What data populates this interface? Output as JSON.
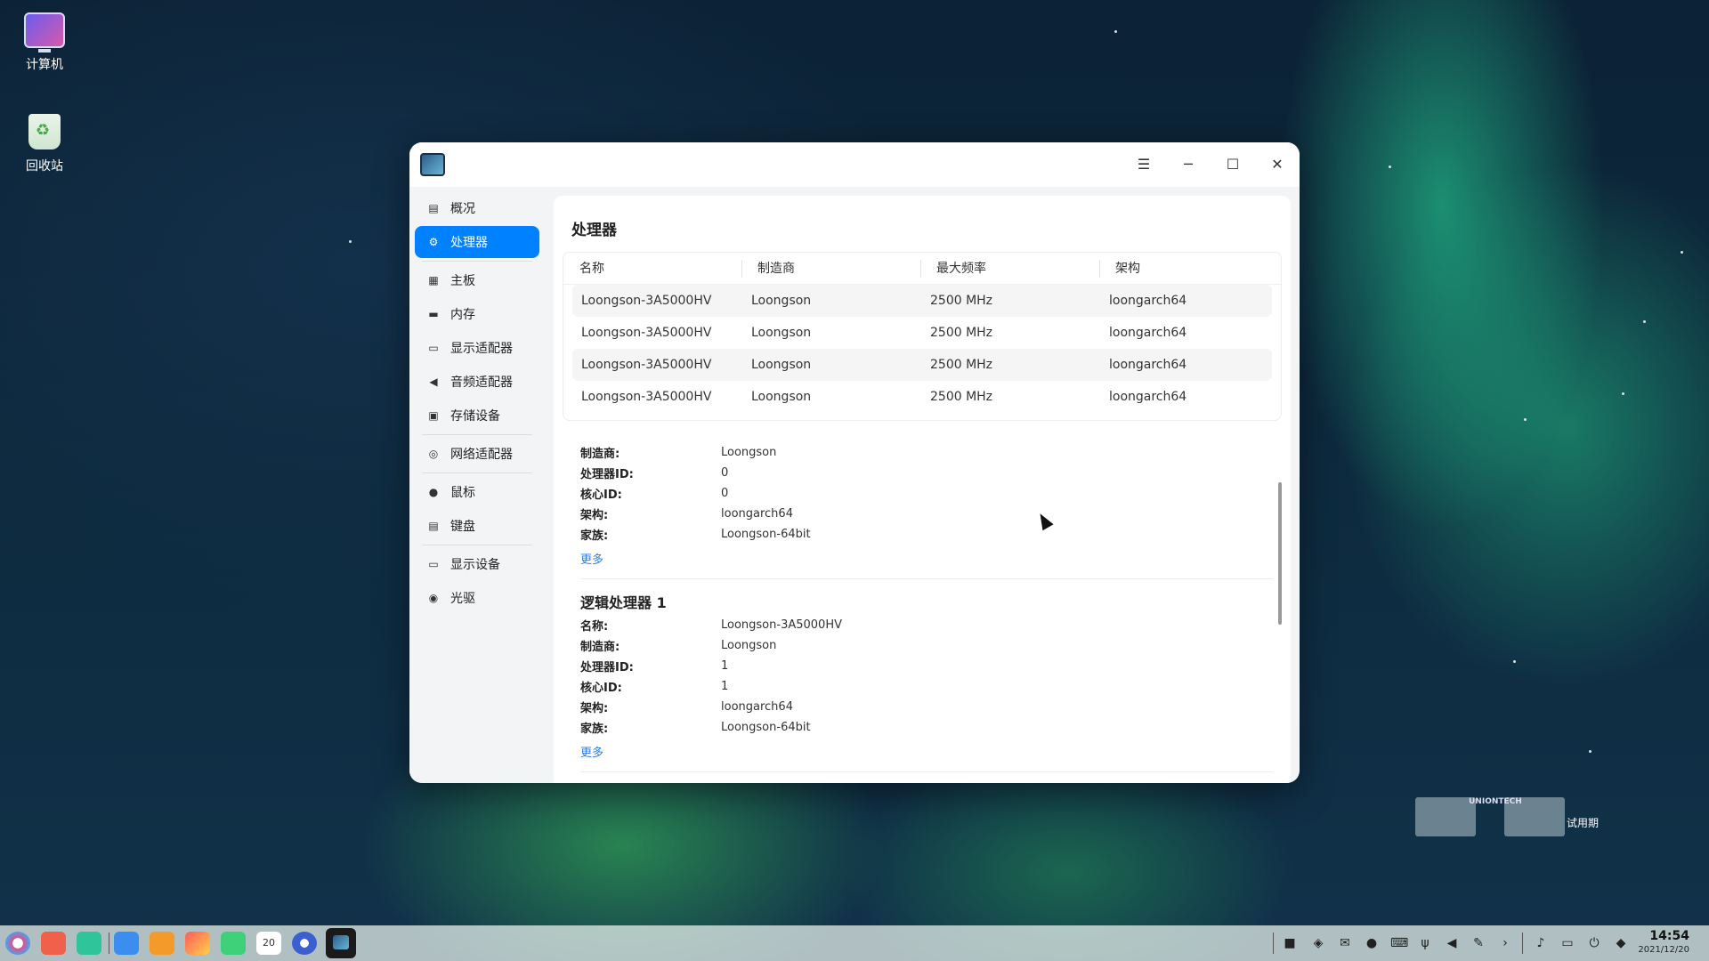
{
  "desktop": {
    "icons": [
      {
        "label": "计算机",
        "icon": "computer-icon"
      },
      {
        "label": "回收站",
        "icon": "trash-icon"
      }
    ]
  },
  "window": {
    "title_icon": "device-manager-icon",
    "controls": {
      "menu": "☰",
      "minimize": "─",
      "maximize": "☐",
      "close": "✕"
    },
    "sidebar": {
      "items": [
        {
          "label": "概况",
          "icon": "overview-icon",
          "active": false
        },
        {
          "label": "处理器",
          "icon": "cpu-icon",
          "active": true
        },
        {
          "label": "主板",
          "icon": "motherboard-icon",
          "active": false
        },
        {
          "label": "内存",
          "icon": "memory-icon",
          "active": false
        },
        {
          "label": "显示适配器",
          "icon": "display-adapter-icon",
          "active": false
        },
        {
          "label": "音频适配器",
          "icon": "audio-adapter-icon",
          "active": false
        },
        {
          "label": "存储设备",
          "icon": "storage-icon",
          "active": false
        },
        {
          "label": "网络适配器",
          "icon": "network-adapter-icon",
          "active": false
        },
        {
          "label": "鼠标",
          "icon": "mouse-icon",
          "active": false
        },
        {
          "label": "键盘",
          "icon": "keyboard-icon",
          "active": false
        },
        {
          "label": "显示设备",
          "icon": "monitor-icon",
          "active": false
        },
        {
          "label": "光驱",
          "icon": "optical-drive-icon",
          "active": false
        }
      ]
    },
    "main": {
      "title": "处理器",
      "table": {
        "headers": [
          "名称",
          "制造商",
          "最大频率",
          "架构"
        ],
        "rows": [
          [
            "Loongson-3A5000HV",
            "Loongson",
            "2500 MHz",
            "loongarch64"
          ],
          [
            "Loongson-3A5000HV",
            "Loongson",
            "2500 MHz",
            "loongarch64"
          ],
          [
            "Loongson-3A5000HV",
            "Loongson",
            "2500 MHz",
            "loongarch64"
          ],
          [
            "Loongson-3A5000HV",
            "Loongson",
            "2500 MHz",
            "loongarch64"
          ]
        ]
      },
      "detail0": {
        "fields": [
          {
            "key": "制造商:",
            "value": "Loongson"
          },
          {
            "key": "处理器ID:",
            "value": "0"
          },
          {
            "key": "核心ID:",
            "value": "0"
          },
          {
            "key": "架构:",
            "value": "loongarch64"
          },
          {
            "key": "家族:",
            "value": "Loongson-64bit"
          }
        ],
        "more": "更多"
      },
      "detail1": {
        "title": "逻辑处理器 1",
        "fields": [
          {
            "key": "名称:",
            "value": "Loongson-3A5000HV"
          },
          {
            "key": "制造商:",
            "value": "Loongson"
          },
          {
            "key": "处理器ID:",
            "value": "1"
          },
          {
            "key": "核心ID:",
            "value": "1"
          },
          {
            "key": "架构:",
            "value": "loongarch64"
          },
          {
            "key": "家族:",
            "value": "Loongson-64bit"
          }
        ],
        "more": "更多"
      }
    }
  },
  "watermark": {
    "brand": "UNIONTECH",
    "trial": "试用期"
  },
  "taskbar": {
    "apps": [
      "launcher-icon",
      "multitask-view-icon",
      "file-manager-icon",
      "browser-icon",
      "app-store-icon",
      "image-viewer-icon",
      "music-icon",
      "calendar-icon",
      "control-center-icon",
      "device-manager-icon"
    ],
    "calendar_day": "20",
    "tray": [
      "camera-icon",
      "shield-icon",
      "mail-icon",
      "notes-icon",
      "keyboard-icon",
      "usb-icon",
      "volume-icon",
      "pen-icon",
      "chevron-right-icon",
      "bell-icon",
      "display-icon",
      "power-icon",
      "security-icon"
    ],
    "time": "14:54",
    "date": "2021/12/20"
  }
}
